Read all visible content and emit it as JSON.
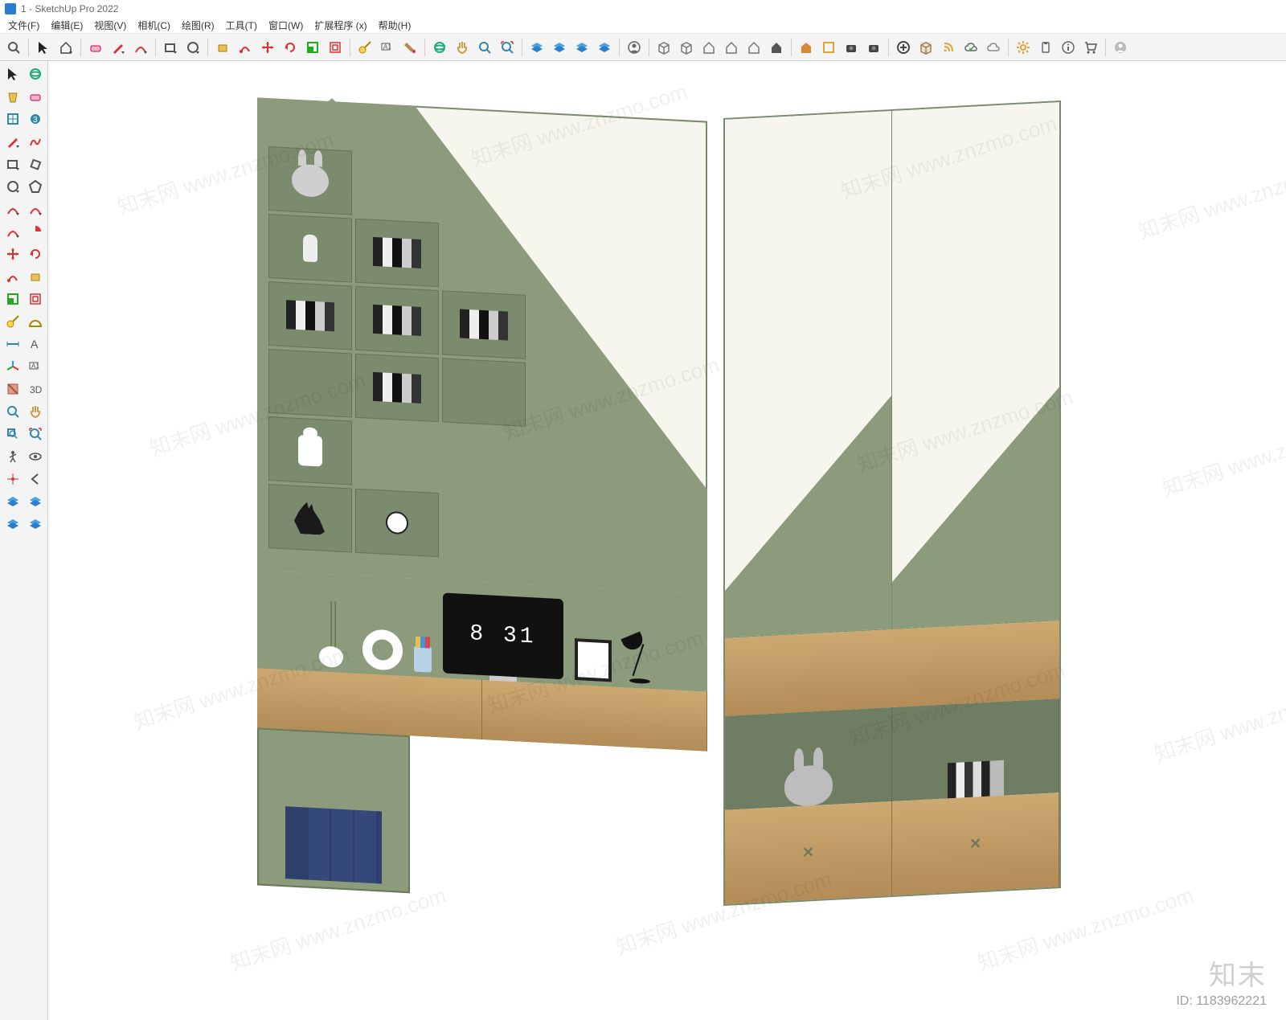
{
  "app": {
    "document_name": "1",
    "title_suffix": "SketchUp Pro 2022"
  },
  "menu": {
    "file": "文件(F)",
    "edit": "编辑(E)",
    "view": "视图(V)",
    "camera": "相机(C)",
    "draw": "绘图(R)",
    "tools": "工具(T)",
    "window": "窗口(W)",
    "ext": "扩展程序 (x)",
    "help": "帮助(H)"
  },
  "toolbar_main": [
    {
      "name": "search-icon",
      "glyph": "search"
    },
    {
      "sep": true
    },
    {
      "name": "select-icon",
      "glyph": "cursor"
    },
    {
      "name": "home-dropdown-icon",
      "glyph": "home-dd"
    },
    {
      "sep": true
    },
    {
      "name": "eraser-icon",
      "glyph": "eraser"
    },
    {
      "name": "pencil-dropdown-icon",
      "glyph": "pencil-dd"
    },
    {
      "name": "arc-dropdown-icon",
      "glyph": "arc-dd"
    },
    {
      "sep": true
    },
    {
      "name": "rectangle-dropdown-icon",
      "glyph": "rect-dd"
    },
    {
      "name": "circle-dropdown-icon",
      "glyph": "circle-dd"
    },
    {
      "sep": true
    },
    {
      "name": "pushpull-icon",
      "glyph": "pushpull"
    },
    {
      "name": "followme-icon",
      "glyph": "followme"
    },
    {
      "name": "move-icon",
      "glyph": "move"
    },
    {
      "name": "rotate-icon",
      "glyph": "rotate"
    },
    {
      "name": "scale-icon",
      "glyph": "scale"
    },
    {
      "name": "offset-icon",
      "glyph": "offset"
    },
    {
      "sep": true
    },
    {
      "name": "tape-icon",
      "glyph": "tape"
    },
    {
      "name": "text-label-icon",
      "glyph": "textlabel"
    },
    {
      "name": "paint-icon",
      "glyph": "paint"
    },
    {
      "sep": true
    },
    {
      "name": "orbit-icon",
      "glyph": "orbit"
    },
    {
      "name": "pan-icon",
      "glyph": "pan"
    },
    {
      "name": "zoom-icon",
      "glyph": "zoom"
    },
    {
      "name": "zoom-extents-icon",
      "glyph": "zoomext"
    },
    {
      "sep": true
    },
    {
      "name": "layers-a-icon",
      "glyph": "layers-blue"
    },
    {
      "name": "layers-b-icon",
      "glyph": "layers-blue2"
    },
    {
      "name": "layers-c-icon",
      "glyph": "layers-blue3"
    },
    {
      "name": "layers-d-icon",
      "glyph": "layers-blue4"
    },
    {
      "sep": true
    },
    {
      "name": "user-circle-icon",
      "glyph": "user"
    },
    {
      "sep": true
    },
    {
      "name": "box-a-icon",
      "glyph": "box"
    },
    {
      "name": "box-b-icon",
      "glyph": "box"
    },
    {
      "name": "house-a-icon",
      "glyph": "house"
    },
    {
      "name": "house-b-icon",
      "glyph": "house"
    },
    {
      "name": "house-c-icon",
      "glyph": "house"
    },
    {
      "name": "house-d-icon",
      "glyph": "house-dark"
    },
    {
      "sep": true
    },
    {
      "name": "warehouse-icon",
      "glyph": "warehouse"
    },
    {
      "name": "panel-icon",
      "glyph": "panel"
    },
    {
      "name": "camera-a-icon",
      "glyph": "camera"
    },
    {
      "name": "camera-b-icon",
      "glyph": "camera"
    },
    {
      "sep": true
    },
    {
      "name": "plus-circle-icon",
      "glyph": "pluscircle"
    },
    {
      "name": "cube-orange-icon",
      "glyph": "cube-o"
    },
    {
      "name": "rss-icon",
      "glyph": "rss"
    },
    {
      "name": "cloud-check-icon",
      "glyph": "cloud"
    },
    {
      "name": "cloud-icon",
      "glyph": "cloud2"
    },
    {
      "sep": true
    },
    {
      "name": "gear-icon",
      "glyph": "gear"
    },
    {
      "name": "clipboard-icon",
      "glyph": "clip"
    },
    {
      "name": "info-icon",
      "glyph": "info"
    },
    {
      "name": "cart-icon",
      "glyph": "cart"
    },
    {
      "sep": true
    },
    {
      "name": "profile-icon",
      "glyph": "profile"
    }
  ],
  "toolbar_side": [
    "select-icon",
    "orbit-icon",
    "bucket-icon",
    "eraser-icon",
    "component-icon",
    "three-icon",
    "pencil-icon",
    "freehand-icon",
    "rectangle-icon",
    "rect-rot-icon",
    "circle-icon",
    "polygon-icon",
    "arc1-icon",
    "arc2-icon",
    "arc3-icon",
    "pie-icon",
    "move-red-icon",
    "rotate-red-icon",
    "followme-red-icon",
    "pushpull-red-icon",
    "scale-red-icon",
    "offset-red-icon",
    "tape-yellow-icon",
    "protractor-icon",
    "dimension-icon",
    "text-icon",
    "axes-icon",
    "label-icon",
    "section-icon",
    "3dtext-icon",
    "zoom-side-icon",
    "pan-side-icon",
    "zoom-window-icon",
    "zoom-extent-icon",
    "walk-icon",
    "look-icon",
    "position-icon",
    "prev-icon",
    "layers-side1-icon",
    "layers-side2-icon",
    "layers-side3-icon",
    "layers-side4-icon"
  ],
  "scene": {
    "monitor_time": "8 31"
  },
  "watermark": {
    "text": "知末网 www.znzmo.com",
    "brand": "知末",
    "id_label": "ID: 1183962221"
  }
}
